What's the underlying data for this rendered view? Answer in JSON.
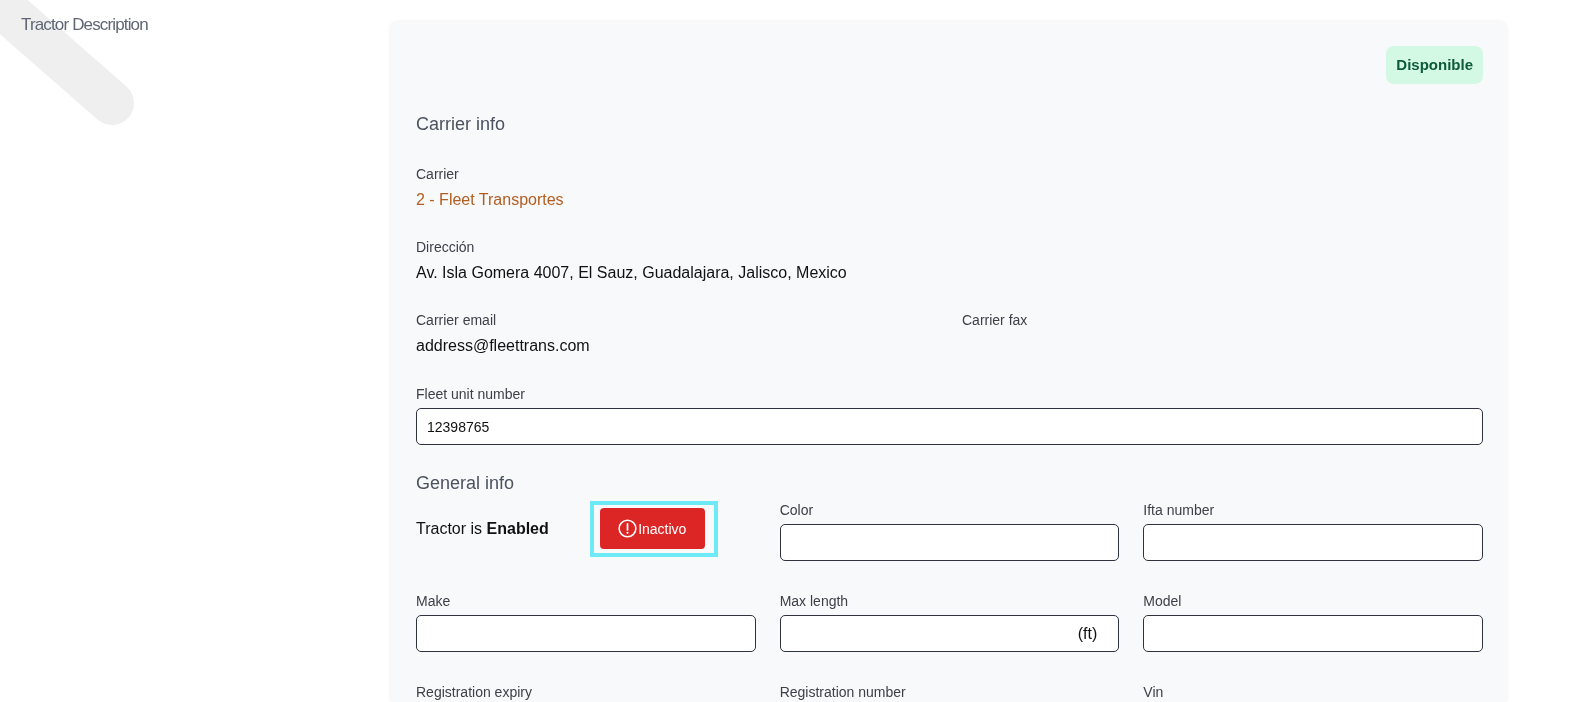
{
  "page": {
    "title": "Tractor Description"
  },
  "status_badge": {
    "label": "Disponible"
  },
  "carrier_info": {
    "heading": "Carrier info",
    "rows": [
      [
        {
          "label": "Carrier",
          "value": "2 - Fleet Transportes",
          "kind": "link"
        }
      ],
      [
        {
          "label": "Dirección",
          "value": "Av. Isla Gomera 4007, El Sauz, Guadalajara, Jalisco, Mexico",
          "kind": "text"
        }
      ],
      [
        {
          "label": "Carrier email",
          "value": "address@fleettrans.com",
          "kind": "text"
        },
        {
          "label": "Carrier fax"
        }
      ]
    ]
  },
  "fleet_unit_number": {
    "label": "Fleet unit number",
    "value": "12398765"
  },
  "general_info": {
    "heading": "General info",
    "status_text": "Tractor is **Enabled**",
    "toggle_button": {
      "label": "Inactivo",
      "focused": true
    },
    "fields": [
      {
        "label": "Color",
        "kind": "input"
      },
      {
        "label": "Ifta number",
        "kind": "input"
      },
      {
        "label": "Make",
        "kind": "input"
      },
      {
        "label": "Max length",
        "kind": "input",
        "suffix": "(ft)"
      },
      {
        "label": "Model",
        "kind": "input"
      },
      {
        "label": "Registration expiry",
        "kind": "label"
      },
      {
        "label": "Registration number",
        "kind": "label"
      },
      {
        "label": "Vin",
        "kind": "label"
      }
    ]
  }
}
